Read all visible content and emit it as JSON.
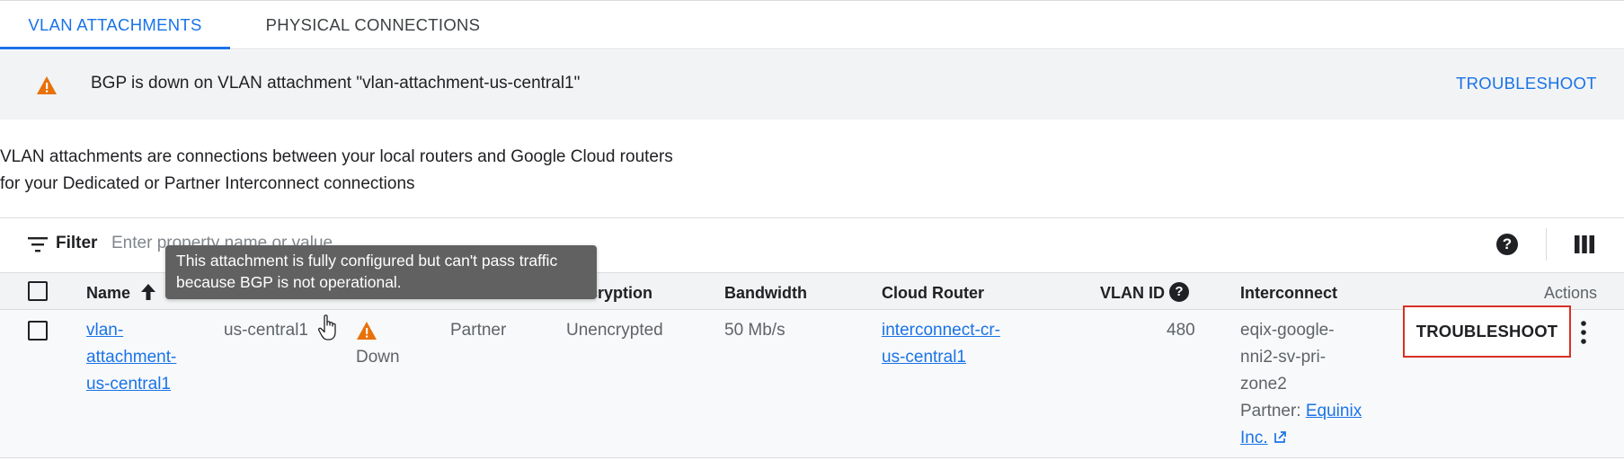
{
  "tabs": [
    {
      "label": "VLAN ATTACHMENTS",
      "active": true
    },
    {
      "label": "PHYSICAL CONNECTIONS",
      "active": false
    }
  ],
  "banner": {
    "icon": "warning-icon",
    "message": "BGP is down on VLAN attachment \"vlan-attachment-us-central1\"",
    "action_label": "TROUBLESHOOT"
  },
  "description": {
    "line1": "VLAN attachments are connections between your local routers and Google Cloud routers",
    "line2": "for your Dedicated or Partner Interconnect connections"
  },
  "filter": {
    "label": "Filter",
    "placeholder": "Enter property name or value"
  },
  "table": {
    "columns": {
      "name": "Name",
      "bandwidth": "Bandwidth",
      "encryption": "Encryption",
      "cloud_router": "Cloud Router",
      "vlan_id": "VLAN ID",
      "interconnect": "Interconnect",
      "actions": "Actions"
    },
    "rows": [
      {
        "name_line1": "vlan-",
        "name_line2": "attachment-",
        "name_line3": "us-central1",
        "region": "us-central1",
        "status": "Down",
        "type": "Partner",
        "encryption": "Unencrypted",
        "bandwidth": "50 Mb/s",
        "cloud_router_line1": "interconnect-cr-",
        "cloud_router_line2": "us-central1",
        "vlan_id": "480",
        "interconnect_line1": "eqix-google-",
        "interconnect_line2": "nni2-sv-pri-",
        "interconnect_line3": "zone2",
        "partner_label": "Partner:",
        "partner_line1": "Equinix",
        "partner_line2": "Inc.",
        "action_label": "TROUBLESHOOT"
      }
    ]
  },
  "tooltip": {
    "line1": "This attachment is fully configured but can't pass traffic",
    "line2": "because BGP is not operational."
  },
  "colors": {
    "accent": "#1a73e8",
    "warning": "#e8710a",
    "highlight_border": "#d93025"
  }
}
